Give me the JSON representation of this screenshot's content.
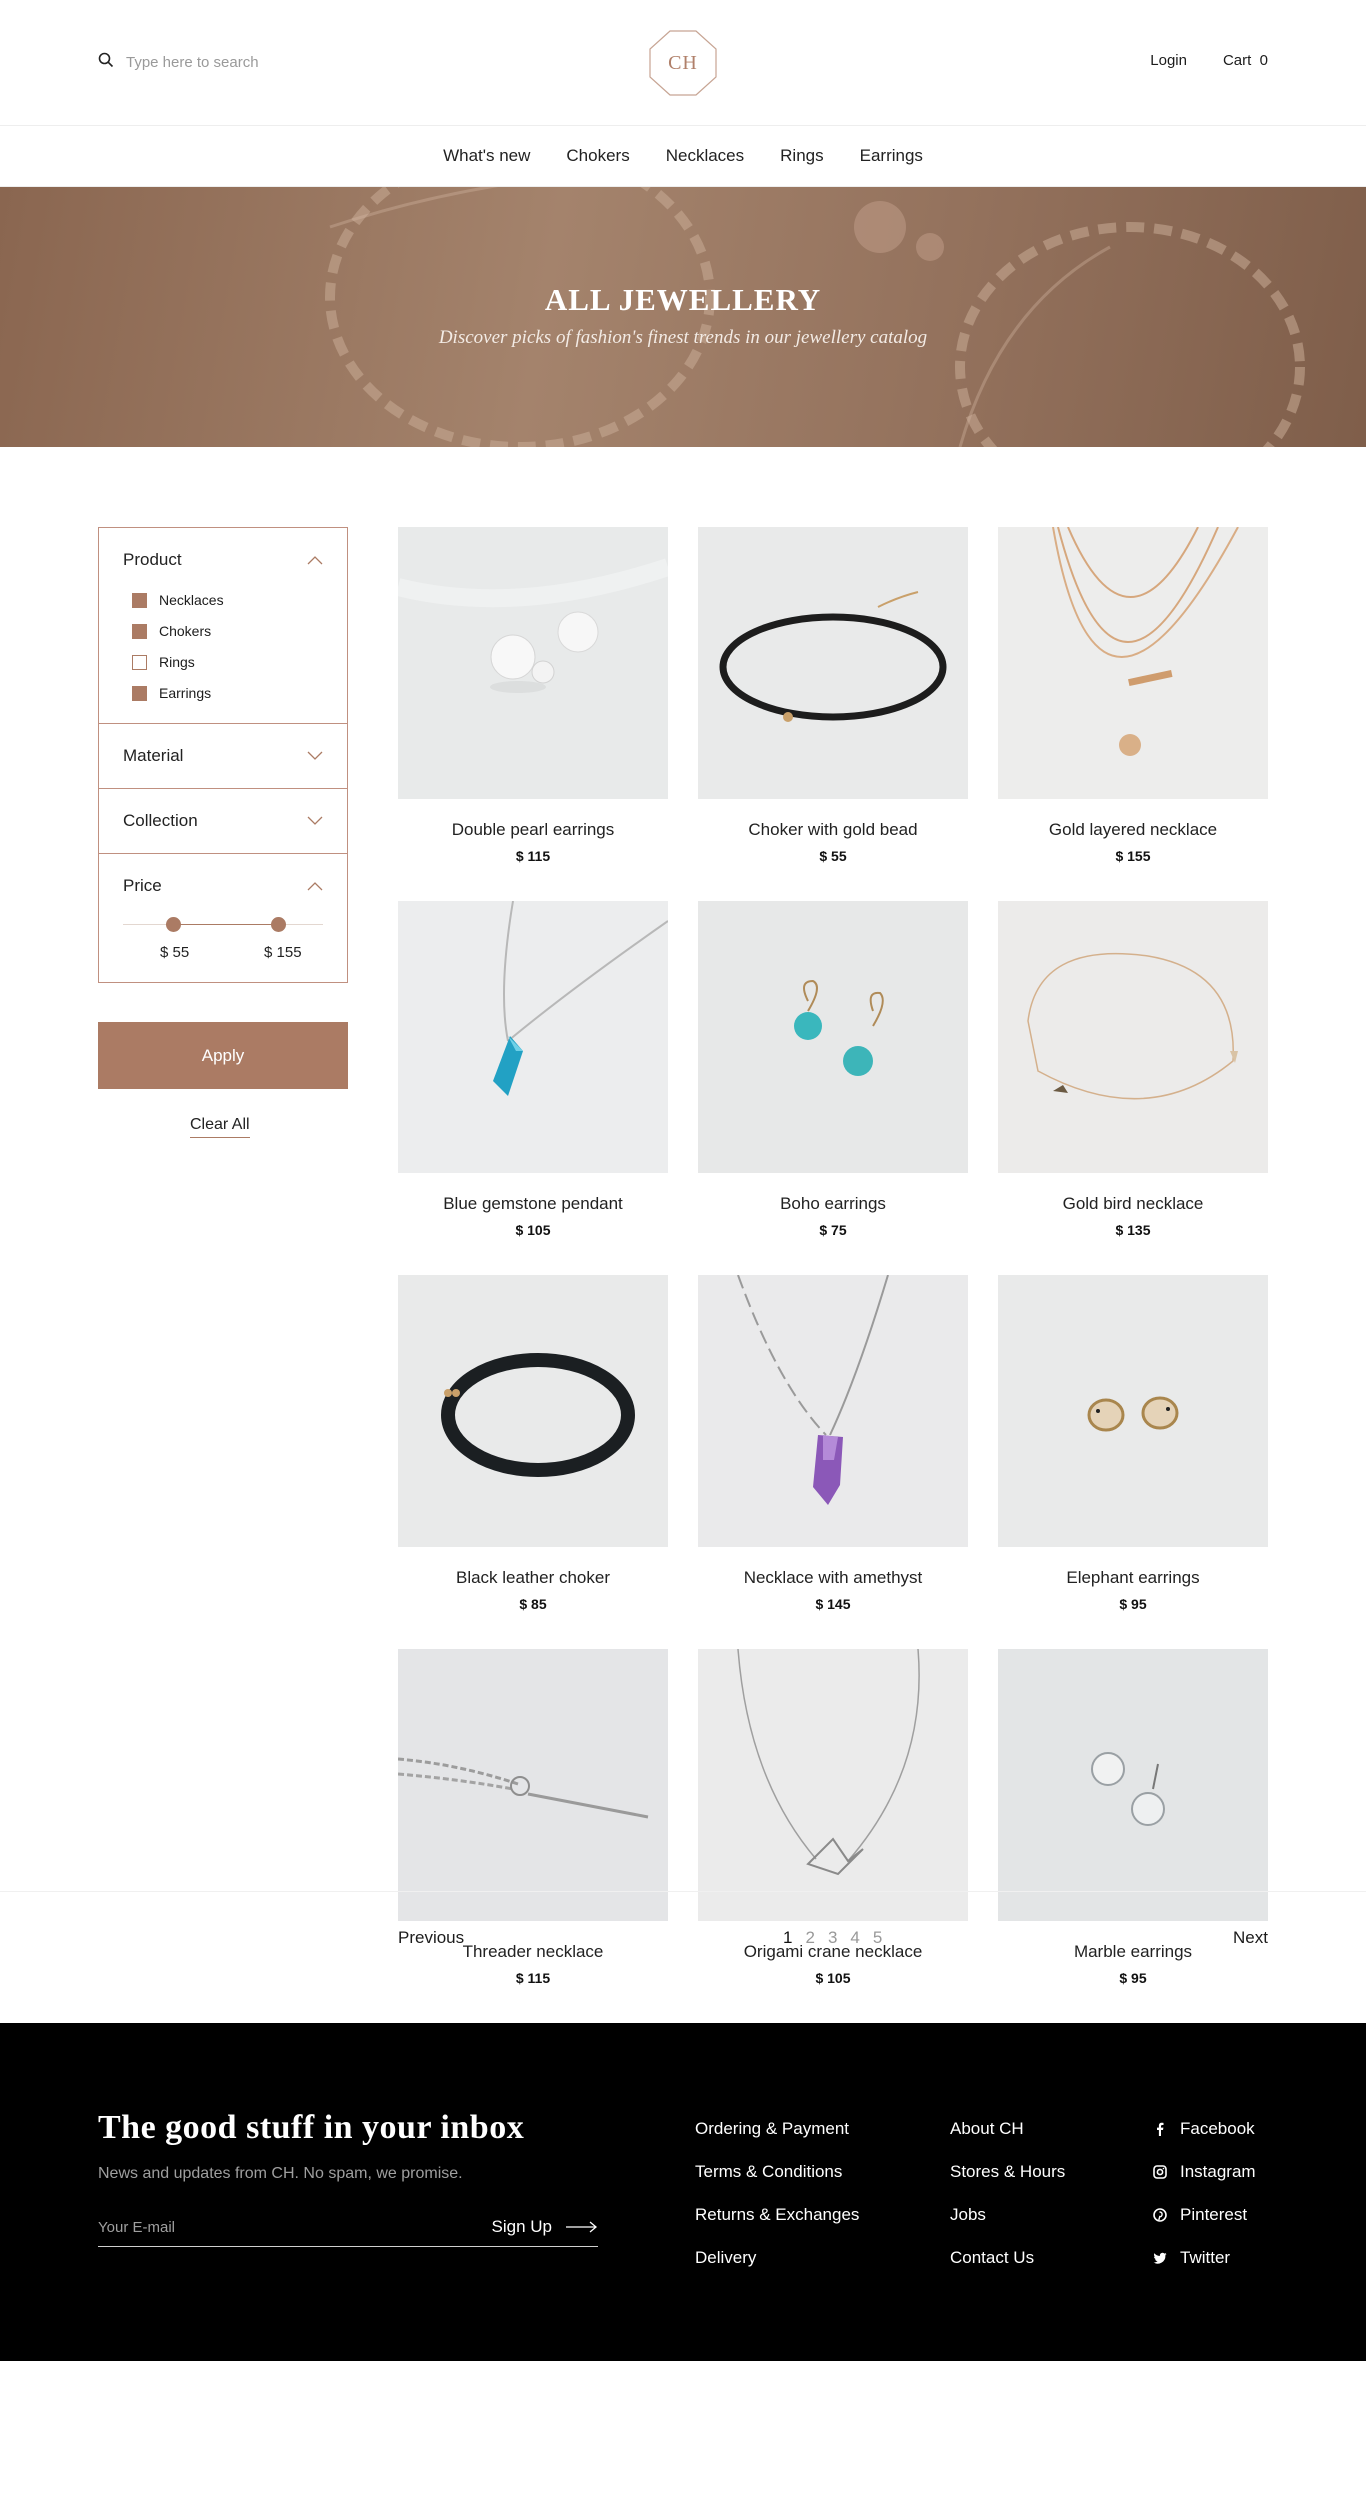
{
  "header": {
    "search_placeholder": "Type here to search",
    "logo": "CH",
    "login": "Login",
    "cart": "Cart",
    "cart_count": "0"
  },
  "nav": [
    {
      "label": "What's new"
    },
    {
      "label": "Chokers"
    },
    {
      "label": "Necklaces"
    },
    {
      "label": "Rings"
    },
    {
      "label": "Earrings"
    }
  ],
  "hero": {
    "title": "ALL JEWELLERY",
    "subtitle": "Discover picks of fashion's finest trends in our jewellery catalog"
  },
  "filters": {
    "product": {
      "title": "Product",
      "options": [
        {
          "label": "Necklaces",
          "checked": true
        },
        {
          "label": "Chokers",
          "checked": true
        },
        {
          "label": "Rings",
          "checked": false
        },
        {
          "label": "Earrings",
          "checked": true
        }
      ]
    },
    "material": {
      "title": "Material"
    },
    "collection": {
      "title": "Collection"
    },
    "price": {
      "title": "Price",
      "min_label": "$ 55",
      "max_label": "$ 155"
    },
    "apply": "Apply",
    "clear": "Clear All"
  },
  "products": [
    {
      "name": "Double pearl earrings",
      "price": "$ 115"
    },
    {
      "name": "Choker with gold bead",
      "price": "$ 55"
    },
    {
      "name": "Gold layered necklace",
      "price": "$ 155"
    },
    {
      "name": "Blue gemstone pendant",
      "price": "$ 105"
    },
    {
      "name": "Boho earrings",
      "price": "$ 75"
    },
    {
      "name": "Gold bird necklace",
      "price": "$ 135"
    },
    {
      "name": "Black leather choker",
      "price": "$ 85"
    },
    {
      "name": "Necklace with amethyst",
      "price": "$ 145"
    },
    {
      "name": "Elephant earrings",
      "price": "$ 95"
    },
    {
      "name": "Threader necklace",
      "price": "$ 115"
    },
    {
      "name": "Origami crane necklace",
      "price": "$ 105"
    },
    {
      "name": "Marble earrings",
      "price": "$ 95"
    }
  ],
  "pagination": {
    "previous": "Previous",
    "next": "Next",
    "pages": [
      "1",
      "2",
      "3",
      "4",
      "5"
    ]
  },
  "footer": {
    "title": "The good stuff in your inbox",
    "subtitle": "News and updates from CH. No spam, we promise.",
    "email_placeholder": "Your E-mail",
    "signup": "Sign Up",
    "col1": [
      "Ordering & Payment",
      "Terms & Conditions",
      "Returns & Exchanges",
      "Delivery"
    ],
    "col2": [
      "About CH",
      "Stores & Hours",
      "Jobs",
      "Contact Us"
    ],
    "social": [
      {
        "label": "Facebook",
        "icon": "facebook-icon"
      },
      {
        "label": "Instagram",
        "icon": "instagram-icon"
      },
      {
        "label": "Pinterest",
        "icon": "pinterest-icon"
      },
      {
        "label": "Twitter",
        "icon": "twitter-icon"
      }
    ]
  },
  "colors": {
    "accent": "#ab7b64",
    "footer_bg": "#000000"
  }
}
